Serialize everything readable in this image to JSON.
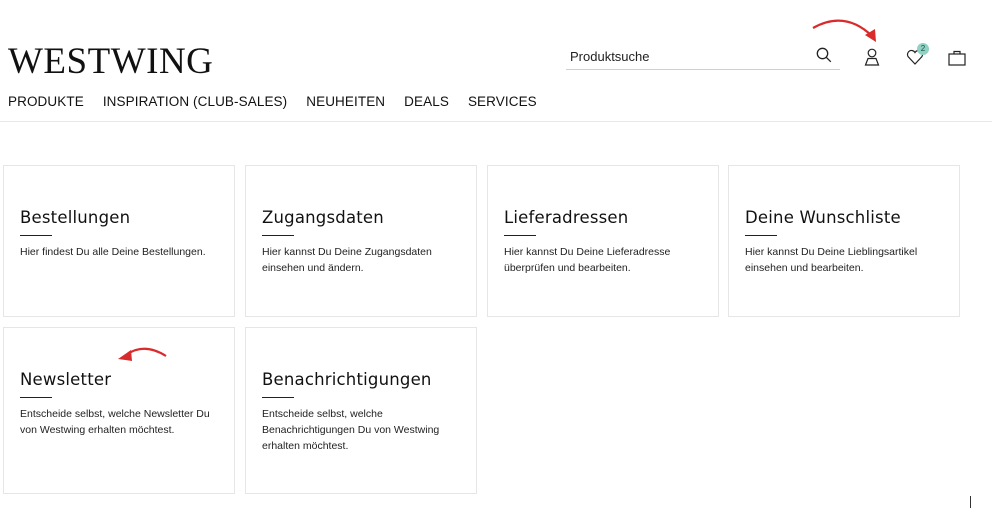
{
  "brand": {
    "logo_text": "WESTWING"
  },
  "nav": {
    "items": [
      "PRODUKTE",
      "INSPIRATION (CLUB-SALES)",
      "NEUHEITEN",
      "DEALS",
      "SERVICES"
    ]
  },
  "search": {
    "placeholder": "Produktsuche"
  },
  "header_icons": {
    "wishlist_count": "2",
    "search_icon": "search-icon",
    "account_icon": "user-icon",
    "wishlist_icon": "heart-icon",
    "cart_icon": "shopping-bag-icon"
  },
  "cards": [
    {
      "title": "Bestellungen",
      "text": "Hier findest Du alle Deine Bestellungen."
    },
    {
      "title": "Zugangsdaten",
      "text": "Hier kannst Du Deine Zugangsdaten einsehen und ändern."
    },
    {
      "title": "Lieferadressen",
      "text": "Hier kannst Du Deine Lieferadresse überprüfen und bearbeiten."
    },
    {
      "title": "Deine Wunschliste",
      "text": "Hier kannst Du Deine Lieblingsartikel einsehen und bearbeiten."
    },
    {
      "title": "Newsletter",
      "text": "Entscheide selbst, welche Newsletter Du von Westwing erhalten möchtest."
    },
    {
      "title": "Benachrichtigungen",
      "text": "Entscheide selbst, welche Benachrichtigungen Du von Westwing erhalten möchtest."
    }
  ],
  "colors": {
    "annotation_arrow": "#d92b2b",
    "badge": "#8fd1c2"
  }
}
